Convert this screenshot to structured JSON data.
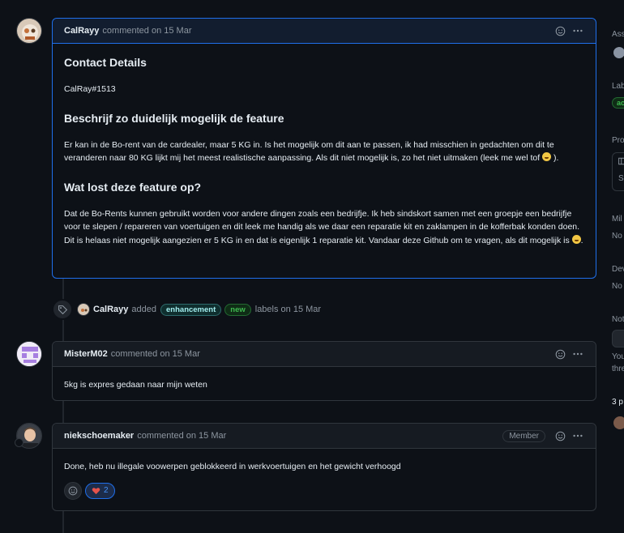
{
  "comments": [
    {
      "author": "CalRayy",
      "meta": "commented on 15 Mar",
      "sections": [
        {
          "heading": "Contact Details",
          "text": "CalRay#1513"
        },
        {
          "heading": "Beschrijf zo duidelijk mogelijk de feature",
          "text": "Er kan in de Bo-rent van de cardealer, maar 5 KG in. Is het mogelijk om dit aan te passen, ik had misschien in gedachten om dit te veranderen naar 80 KG lijkt mij het meest realistische aanpassing. Als dit niet mogelijk is, zo het niet uitmaken (leek me wel tof",
          "text_end": ")."
        },
        {
          "heading": "Wat lost deze feature op?",
          "text": "Dat de Bo-Rents kunnen gebruikt worden voor andere dingen zoals een bedrijfje. Ik heb sindskort samen met een groepje een bedrijfje voor te slepen / repareren van voertuigen en dit leek me handig als we daar een reparatie kit en zaklampen in de kofferbak konden doen. Dit is helaas niet mogelijk aangezien er 5 KG in en dat is eigenlijk 1 reparatie kit. Vandaar deze Github om te vragen, als dit mogelijk is",
          "text_end": "."
        }
      ]
    },
    {
      "author": "MisterM02",
      "meta": "commented on 15 Mar",
      "text": "5kg is expres gedaan naar mijn weten"
    },
    {
      "author": "niekschoemaker",
      "meta": "commented on 15 Mar",
      "badge": "Member",
      "text": "Done, heb nu illegale voowerpen geblokkeerd in werkvoertuigen en het gewicht verhoogd",
      "reaction_count": "2"
    }
  ],
  "event": {
    "author": "CalRayy",
    "action": "added",
    "labels": [
      "enhancement",
      "new"
    ],
    "suffix": "labels on 15 Mar"
  },
  "sidebar": {
    "assignees": "Ass",
    "labels": "Lab",
    "label_chip": "ac",
    "projects": "Pro",
    "project_item": "S",
    "milestone": "Mil",
    "milestone_value": "No",
    "development": "Dev",
    "development_value": "No",
    "notifications": "Not",
    "notif_text1": "You",
    "notif_text2": "thre",
    "participants": "3 p"
  },
  "colors": {
    "background": "#0d1117",
    "accent": "#1f6feb",
    "label_enhancement": "#a2eeef",
    "label_new": "#3fb950"
  }
}
